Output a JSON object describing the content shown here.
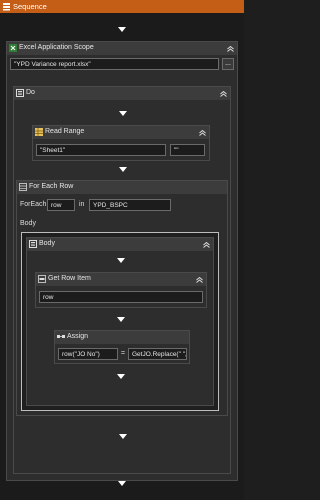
{
  "window": {
    "title": "Sequence"
  },
  "excel_scope": {
    "title": "Excel Application Scope",
    "path_value": "\"YPD Variance report.xlsx\"",
    "browse_label": "..."
  },
  "do_block": {
    "title": "Do"
  },
  "read_range": {
    "title": "Read Range",
    "sheet_value": "\"Sheet1\"",
    "range_value": "\"\""
  },
  "for_each_row": {
    "title": "For Each Row",
    "foreach_label": "ForEach",
    "item_value": "row",
    "in_label": "in",
    "collection_value": "YPD_BSPC",
    "body_label": "Body"
  },
  "body_block": {
    "title": "Body"
  },
  "get_row_item": {
    "title": "Get Row Item",
    "row_value": "row"
  },
  "assign": {
    "title": "Assign",
    "to_value": "row(\"JO No\")",
    "equals": "=",
    "value_value": "GetJO.Replace(\" \",\""
  },
  "colors": {
    "titlebar": "#c45d16",
    "canvas": "#1b1b1b",
    "activity": "#2d2d2d",
    "header": "#3c3c3c"
  }
}
